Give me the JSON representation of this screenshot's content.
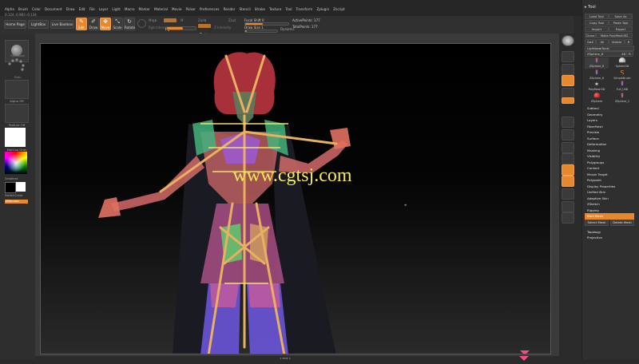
{
  "menu": [
    "Alpha",
    "Brush",
    "Color",
    "Document",
    "Draw",
    "Edit",
    "File",
    "Layer",
    "Light",
    "Macro",
    "Marker",
    "Material",
    "Movie",
    "Picker",
    "Preferences",
    "Render",
    "Stencil",
    "Stroke",
    "Texture",
    "Tool",
    "Transform",
    "Zplugin",
    "Zscript"
  ],
  "coord_readout": "0.124,-0.983,-0.134",
  "toolbar": {
    "home": "Home Page",
    "lightbox": "LightBox",
    "live_boolean": "Live Boolean",
    "edit": "Edit",
    "draw": "Draw",
    "move": "Move",
    "scale": "Scale",
    "rotate": "Rotate",
    "mrgb": "Mrgb",
    "rgb": "Rgb",
    "m": "M",
    "zadd": "Zadd",
    "zsub": "Zsub",
    "zcut": "Zcut",
    "rgb_intensity": "Rgb Intensity",
    "z_intensity": "Z Intensity",
    "focal_shift_label": "Focal Shift",
    "focal_shift_value": "0",
    "draw_size_label": "Draw Size",
    "draw_size_value": "1",
    "dynamic": "Dynamic",
    "active_points_label": "ActivePoints:",
    "active_points_value": "177",
    "total_points_label": "TotalPoints:",
    "total_points_value": "177"
  },
  "left": {
    "brush": "Standard",
    "stroke": "Dots",
    "alpha": "Alpha Off",
    "texture": "Texture Off",
    "material": "MatCap Gray",
    "gradient": "Gradient",
    "switch_color": "SwitchColor",
    "alternate": "Alternate"
  },
  "watermark": "www.cgtsj.com",
  "accent": "#e8882d",
  "tool_panel": {
    "header": "Tool",
    "load_tool": "Load Tool",
    "save_as": "Save As",
    "copy_tool": "Copy Tool",
    "paste_tool": "Paste Tool",
    "import": "Import",
    "export": "Export",
    "clone": "Clone",
    "make_polymesh": "Make PolyMesh3D",
    "goz": "GoZ",
    "all": "All",
    "visible": "Visible",
    "r": "R",
    "lightbox_tools": "Lightbox▸Tools",
    "zsphere_label": "ZSphere_6",
    "zsphere_value": "48",
    "r2": "R",
    "thumbs": [
      {
        "label": "ZSphere_6",
        "icon": "figure-icon"
      },
      {
        "label": "Sphere3D",
        "icon": "sphere-icon"
      },
      {
        "label": "ZSphere_6",
        "icon": "figure-icon"
      },
      {
        "label": "SimpleBrush",
        "icon": "simplebrush-icon"
      },
      {
        "label": "PolyMesh3D",
        "icon": "star-icon"
      },
      {
        "label": "Full_USB",
        "icon": "figure-icon"
      },
      {
        "label": "ZSphere",
        "icon": "zsphere-icon"
      },
      {
        "label": "ZSphere_1",
        "icon": "figure-icon"
      }
    ],
    "items": [
      "Subtool",
      "Geometry",
      "Layers",
      "FiberMesh",
      "Preview",
      "Surface",
      "Deformation",
      "Masking",
      "Visibility",
      "Polygroups",
      "Contact",
      "Morph Target",
      "Polypaint",
      "Display Properties",
      "Unified Skin",
      "Adaptive Skin",
      "ZSketch",
      "Rigging"
    ],
    "bind_mesh": "Bind Mesh",
    "select_mesh": "Select Mesh",
    "delete_mesh": "Delete Mesh",
    "items2": [
      "Topology",
      "Projection"
    ]
  }
}
